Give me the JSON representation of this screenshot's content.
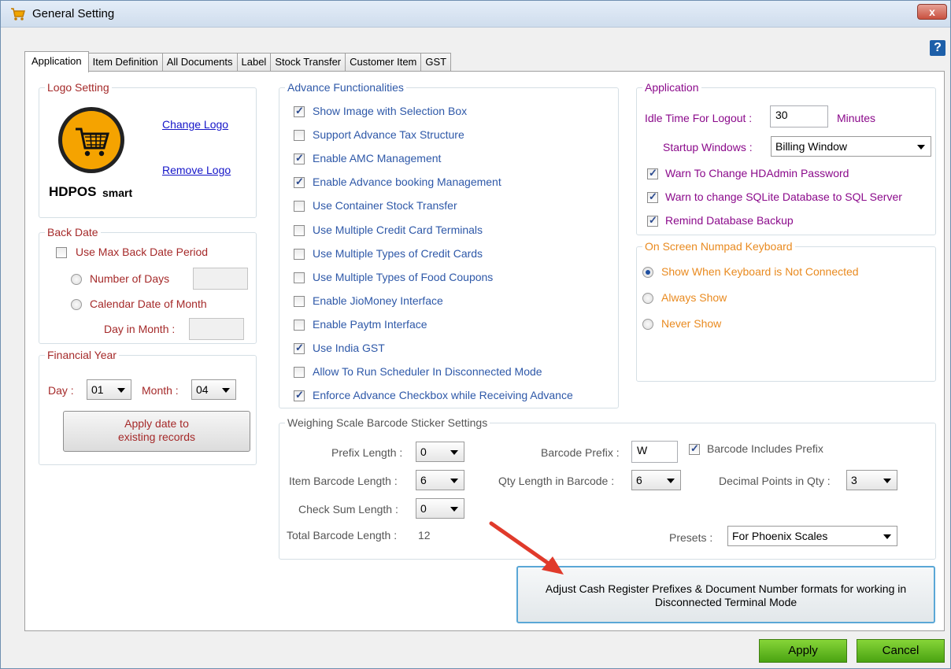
{
  "window": {
    "title": "General Setting",
    "close_label": "x",
    "help_label": "?"
  },
  "tabs": [
    {
      "label": "Application"
    },
    {
      "label": "Item Definition"
    },
    {
      "label": "All Documents"
    },
    {
      "label": "Label"
    },
    {
      "label": "Stock Transfer"
    },
    {
      "label": "Customer Item"
    },
    {
      "label": "GST"
    }
  ],
  "logo_setting": {
    "title": "Logo Setting",
    "logo_text_main": "HDPOS",
    "logo_text_sub": "smart",
    "change_logo": "Change Logo",
    "remove_logo": "Remove Logo"
  },
  "back_date": {
    "title": "Back Date",
    "use_max_label": "Use Max Back Date Period",
    "use_max_checked": false,
    "number_of_days_label": "Number of Days",
    "calendar_date_label": "Calendar Date of Month",
    "day_in_month_label": "Day in Month :",
    "number_of_days_value": "",
    "day_in_month_value": ""
  },
  "financial_year": {
    "title": "Financial Year",
    "day_label": "Day :",
    "day_value": "01",
    "month_label": "Month :",
    "month_value": "04",
    "apply_button_line1": "Apply date to",
    "apply_button_line2": "existing records"
  },
  "advance": {
    "title": "Advance Functionalities",
    "items": [
      {
        "label": "Show Image with Selection Box",
        "checked": true
      },
      {
        "label": "Support Advance Tax Structure",
        "checked": false
      },
      {
        "label": "Enable AMC Management",
        "checked": true
      },
      {
        "label": "Enable Advance booking Management",
        "checked": true
      },
      {
        "label": "Use Container Stock Transfer",
        "checked": false
      },
      {
        "label": "Use Multiple Credit Card Terminals",
        "checked": false
      },
      {
        "label": "Use Multiple Types of Credit Cards",
        "checked": false
      },
      {
        "label": "Use Multiple Types of Food Coupons",
        "checked": false
      },
      {
        "label": "Enable JioMoney Interface",
        "checked": false
      },
      {
        "label": "Enable Paytm Interface",
        "checked": false
      },
      {
        "label": "Use India GST",
        "checked": true
      },
      {
        "label": "Allow To Run Scheduler In Disconnected Mode",
        "checked": false
      },
      {
        "label": "Enforce Advance Checkbox while Receiving Advance",
        "checked": true
      }
    ]
  },
  "application": {
    "title": "Application",
    "idle_label": "Idle Time For Logout :",
    "idle_value": "30",
    "idle_unit": "Minutes",
    "startup_label": "Startup Windows :",
    "startup_value": "Billing Window",
    "warn_hdadmin": "Warn To Change HDAdmin Password",
    "warn_sqlite": "Warn to change SQLite Database to SQL Server",
    "remind_backup": "Remind Database Backup"
  },
  "numpad": {
    "title": "On Screen Numpad Keyboard",
    "options": [
      {
        "label": "Show When Keyboard is Not Connected",
        "selected": true
      },
      {
        "label": "Always Show",
        "selected": false
      },
      {
        "label": "Never Show",
        "selected": false
      }
    ]
  },
  "weighing": {
    "title": "Weighing Scale Barcode Sticker Settings",
    "prefix_length_label": "Prefix Length :",
    "prefix_length_value": "0",
    "item_barcode_length_label": "Item Barcode Length :",
    "item_barcode_length_value": "6",
    "check_sum_length_label": "Check Sum Length :",
    "check_sum_length_value": "0",
    "total_barcode_label": "Total Barcode Length :",
    "total_barcode_value": "12",
    "barcode_prefix_label": "Barcode Prefix :",
    "barcode_prefix_value": "W",
    "includes_prefix_label": "Barcode Includes Prefix",
    "qty_length_label": "Qty Length in Barcode :",
    "qty_length_value": "6",
    "decimal_points_label": "Decimal Points in Qty :",
    "decimal_points_value": "3",
    "presets_label": "Presets :",
    "presets_value": "For Phoenix Scales"
  },
  "adjust_button": {
    "line1": "Adjust Cash Register Prefixes & Document Number formats for working in",
    "line2": "Disconnected Terminal Mode"
  },
  "footer": {
    "apply": "Apply",
    "cancel": "Cancel"
  },
  "colors": {
    "accent_red": "#e03a2b",
    "apply_green": "#5cb520"
  }
}
